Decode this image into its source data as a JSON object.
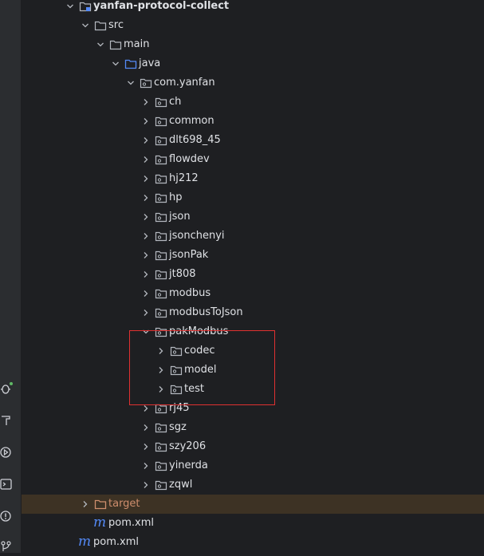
{
  "project_tree": {
    "root": {
      "label": "yanfan-protocol-collect",
      "expanded": true
    },
    "src": {
      "label": "src",
      "expanded": true
    },
    "main": {
      "label": "main",
      "expanded": true
    },
    "java": {
      "label": "java",
      "expanded": true
    },
    "package": {
      "label": "com.yanfan",
      "expanded": true
    },
    "packages_before": [
      {
        "label": "ch"
      },
      {
        "label": "common"
      },
      {
        "label": "dlt698_45"
      },
      {
        "label": "flowdev"
      },
      {
        "label": "hj212"
      },
      {
        "label": "hp"
      },
      {
        "label": "json"
      },
      {
        "label": "jsonchenyi"
      },
      {
        "label": "jsonPak"
      },
      {
        "label": "jt808"
      },
      {
        "label": "modbus"
      },
      {
        "label": "modbusToJson"
      }
    ],
    "pakModbus": {
      "label": "pakModbus",
      "expanded": true
    },
    "pakModbus_children": [
      {
        "label": "codec"
      },
      {
        "label": "model"
      },
      {
        "label": "test"
      }
    ],
    "packages_after": [
      {
        "label": "rj45"
      },
      {
        "label": "sgz"
      },
      {
        "label": "szy206"
      },
      {
        "label": "yinerda"
      },
      {
        "label": "zqwl"
      }
    ],
    "target": {
      "label": "target",
      "expanded": false
    },
    "module_pom": {
      "label": "pom.xml"
    },
    "root_pom": {
      "label": "pom.xml"
    }
  },
  "colors": {
    "background": "#1e1f22",
    "selection": "#3d3224",
    "highlight_box": "#e03131",
    "excluded_text": "#cf8e6d",
    "maven_icon": "#548af7"
  },
  "icons": {
    "module": "module-folder-icon",
    "folder": "folder-icon",
    "source_root": "source-root-folder-icon",
    "package": "package-icon",
    "excluded": "excluded-folder-icon",
    "maven": "maven-pom-icon",
    "chevron_down": "chevron-down-icon",
    "chevron_right": "chevron-right-icon"
  },
  "toolwindow_icons": [
    "bug-debug-icon",
    "hammer-build-icon",
    "run-services-icon",
    "terminal-icon",
    "problems-icon",
    "git-icon"
  ]
}
